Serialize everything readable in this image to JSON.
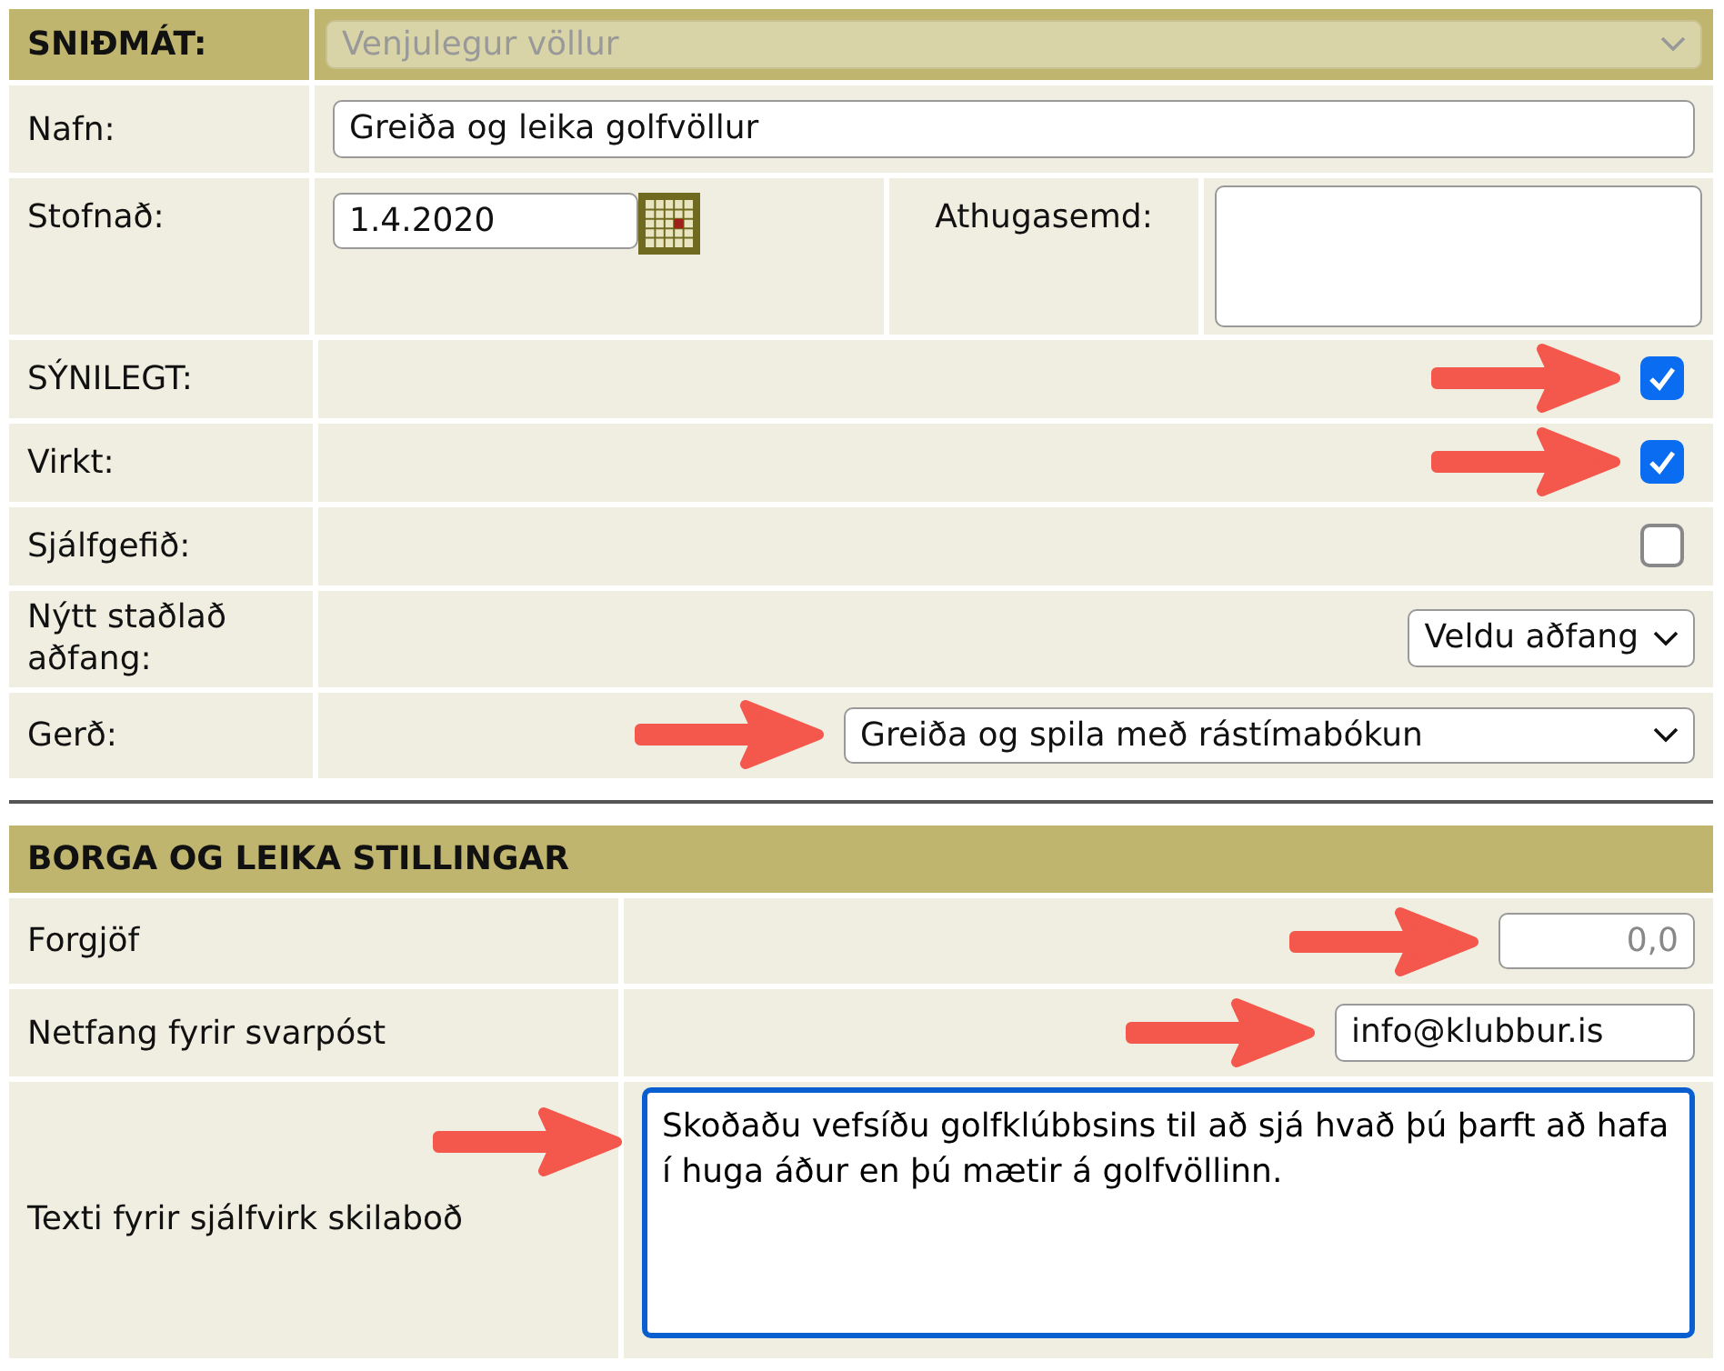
{
  "sections": [
    {
      "header": {
        "label": "SNIÐMÁT:",
        "select": {
          "value": "Venjulegur völlur",
          "disabled": true
        }
      },
      "rows": [
        {
          "kind": "text",
          "label": "Nafn:",
          "value": "Greiða og leika golfvöllur"
        },
        {
          "kind": "date",
          "label": "Stofnað:",
          "value": "1.4.2020",
          "note_label": "Athugasemd:"
        },
        {
          "kind": "checkbox",
          "label": "SÝNILEGT:",
          "checked": true,
          "annotated": true
        },
        {
          "kind": "checkbox",
          "label": "Virkt:",
          "checked": true,
          "annotated": true
        },
        {
          "kind": "checkbox",
          "label": "Sjálfgefið:",
          "checked": false
        },
        {
          "kind": "select",
          "label": "Nýtt staðlað aðfang:",
          "value": "Veldu aðfang"
        },
        {
          "kind": "select_wide",
          "label": "Gerð:",
          "value": "Greiða og spila með rástímabókun",
          "annotated": true
        }
      ]
    },
    {
      "header": {
        "label": "BORGA OG LEIKA STILLINGAR"
      },
      "rows": [
        {
          "kind": "number",
          "label": "Forgjöf",
          "value": "0,0",
          "disabled": true,
          "annotated": true
        },
        {
          "kind": "short",
          "label": "Netfang fyrir svarpóst",
          "value": "info@klubbur.is",
          "annotated": true
        },
        {
          "kind": "textarea",
          "label": "Texti fyrir sjálfvirk skilaboð",
          "value": "Skoðaðu vefsíðu golfklúbbsins til að sjá hvað þú þarft að hafa í huga áður en þú mætir á golfvöllinn.",
          "focused": true,
          "annotated": true
        }
      ]
    }
  ]
}
